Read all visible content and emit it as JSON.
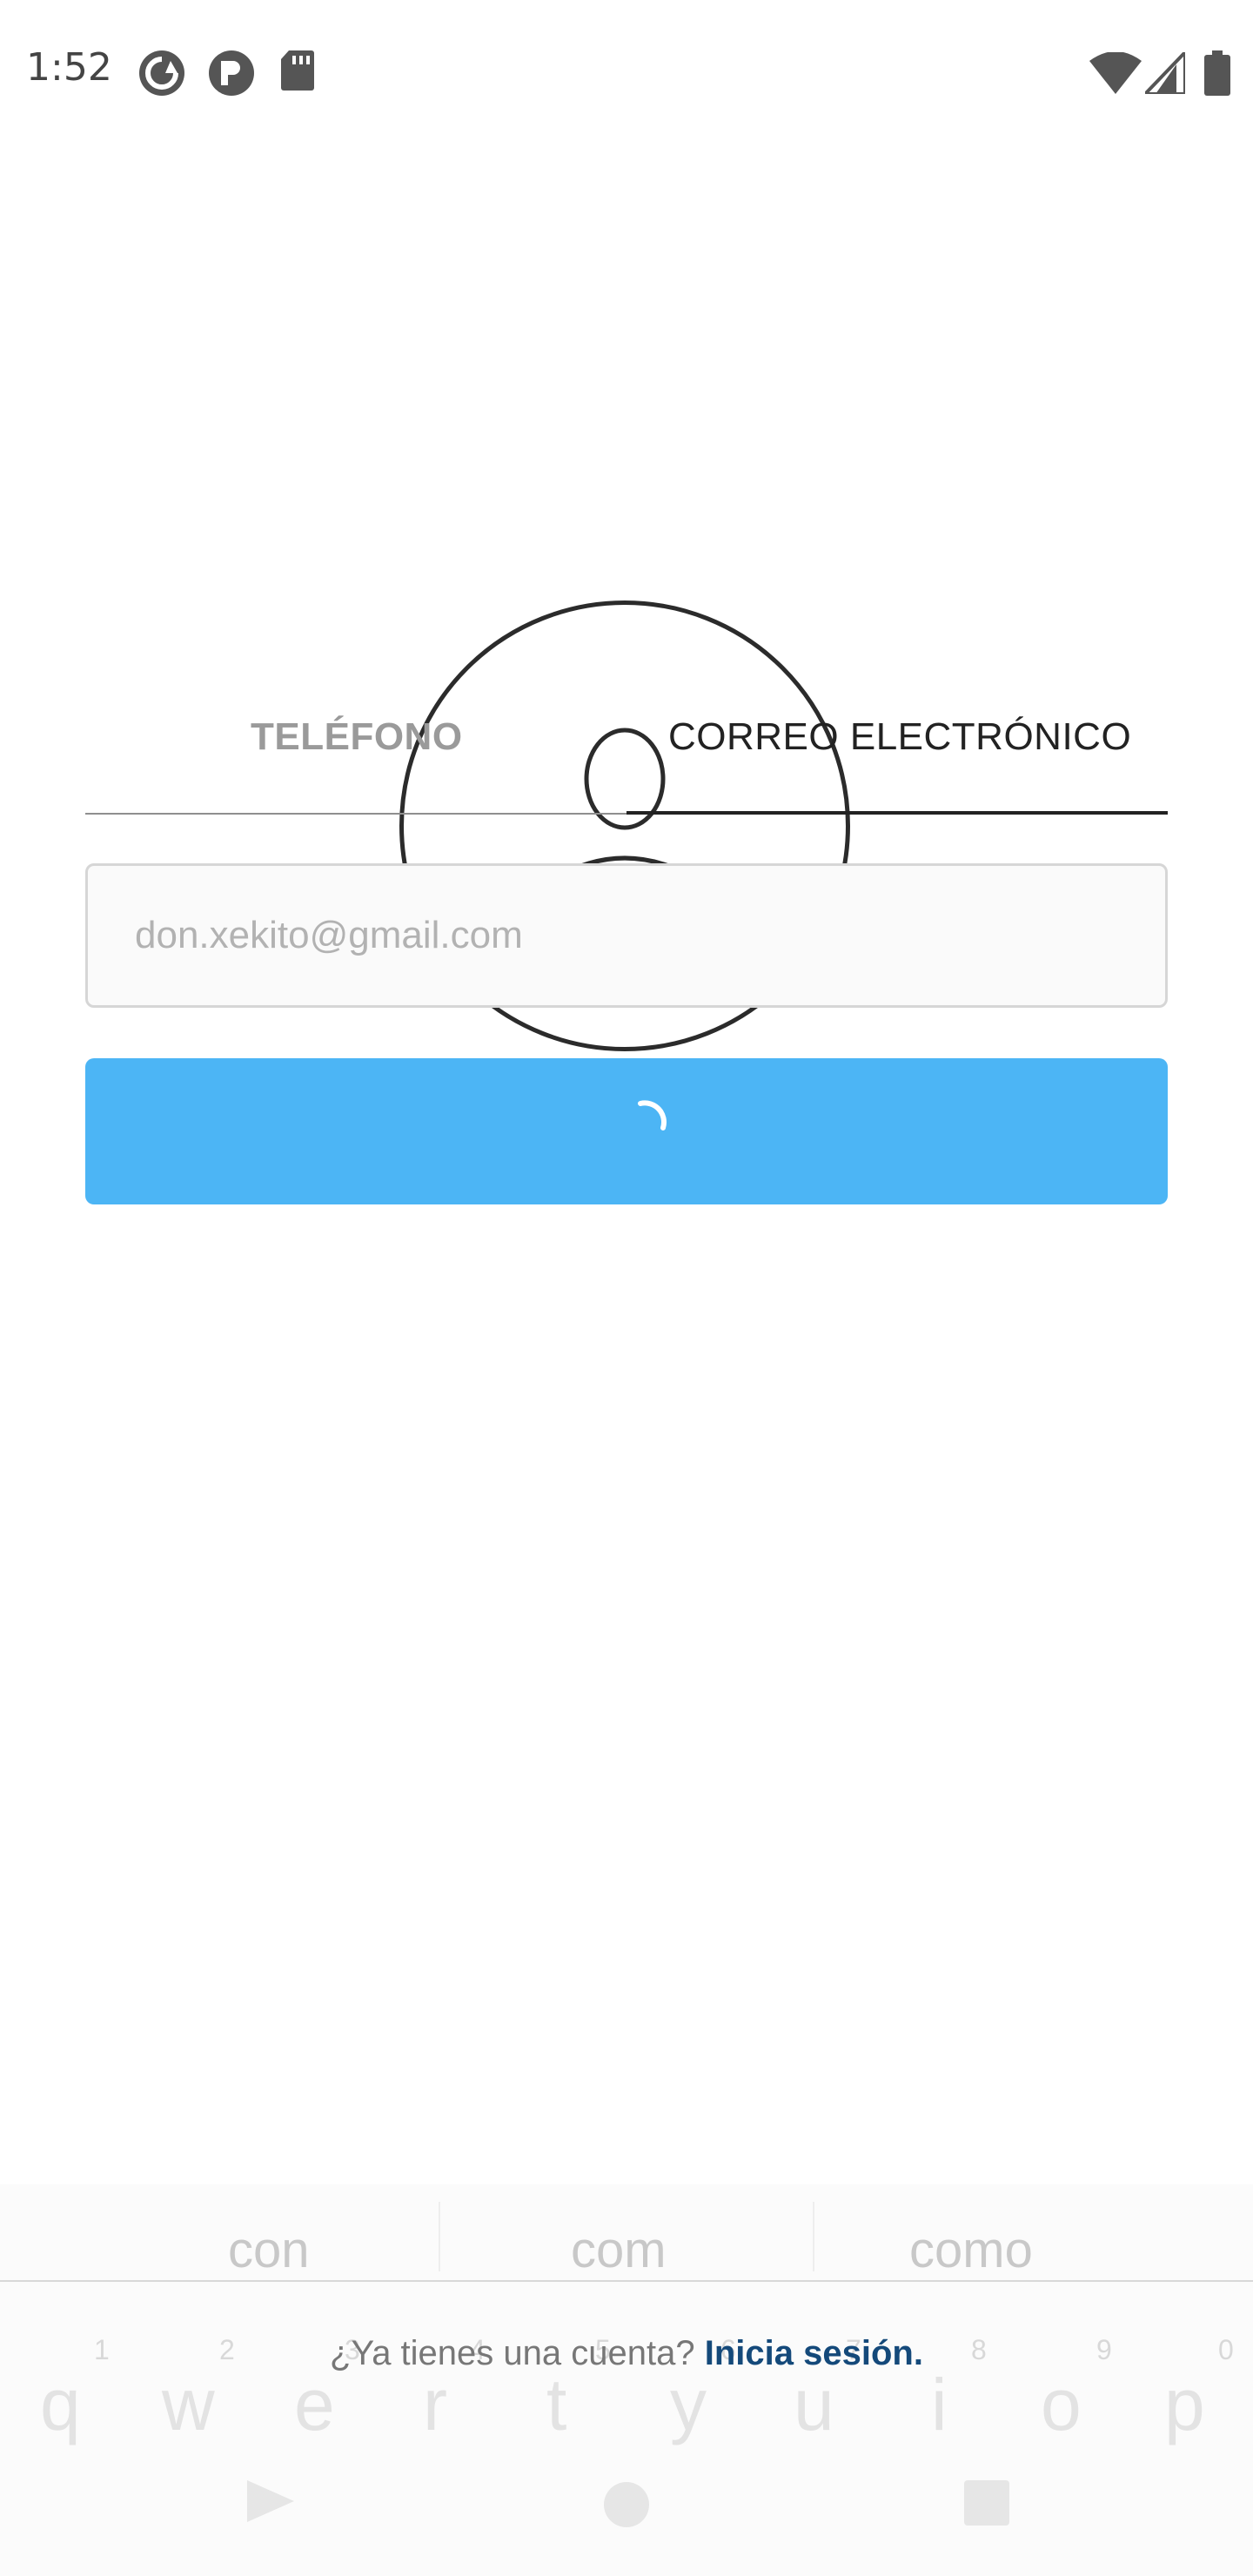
{
  "status_bar": {
    "time": "1:52",
    "icons": [
      "sync-icon",
      "circle-p-icon",
      "sd-card-icon",
      "wifi-icon",
      "signal-icon",
      "battery-icon"
    ]
  },
  "avatar": {
    "icon": "user-placeholder-icon"
  },
  "tabs": [
    {
      "label": "TELÉFONO",
      "selected": false
    },
    {
      "label": "CORREO ELECTRÓNICO",
      "selected": true
    }
  ],
  "email_field": {
    "value": "",
    "placeholder": "don.xekito@gmail.com"
  },
  "submit_button": {
    "state": "loading",
    "icon": "spinner-icon",
    "color": "#4cb5f5"
  },
  "keyboard": {
    "suggestions": [
      "con",
      "com",
      "como"
    ],
    "number_row": [
      "1",
      "2",
      "3",
      "4",
      "5",
      "6",
      "7",
      "8",
      "9",
      "0"
    ],
    "letter_row": [
      "q",
      "w",
      "e",
      "r",
      "t",
      "y",
      "u",
      "i",
      "o",
      "p"
    ]
  },
  "footer": {
    "prompt": "¿Ya tienes una cuenta?",
    "link": "Inicia sesión.",
    "link_color": "#14497a"
  },
  "nav_bar": {
    "icons": [
      "back-icon",
      "home-icon",
      "recents-icon"
    ]
  }
}
